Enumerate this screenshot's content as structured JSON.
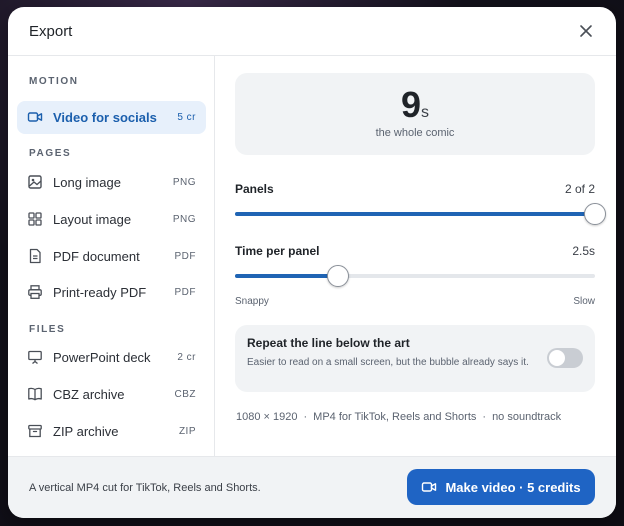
{
  "dialog": {
    "title": "Export",
    "close_icon": "close-icon"
  },
  "sidebar": {
    "sections": [
      {
        "label": "MOTION"
      },
      {
        "label": "PAGES"
      },
      {
        "label": "FILES"
      }
    ],
    "items": [
      {
        "label": "Video for socials",
        "tag": "5 cr",
        "icon": "video-icon",
        "active": true
      },
      {
        "label": "Long image",
        "tag": "PNG",
        "icon": "image-icon"
      },
      {
        "label": "Layout image",
        "tag": "PNG",
        "icon": "grid-icon"
      },
      {
        "label": "PDF document",
        "tag": "PDF",
        "icon": "document-icon"
      },
      {
        "label": "Print-ready PDF",
        "tag": "PDF",
        "icon": "printer-icon"
      },
      {
        "label": "PowerPoint deck",
        "tag": "2 cr",
        "icon": "presentation-icon"
      },
      {
        "label": "CBZ archive",
        "tag": "CBZ",
        "icon": "book-icon"
      },
      {
        "label": "ZIP archive",
        "tag": "ZIP",
        "icon": "archive-icon"
      }
    ]
  },
  "duration": {
    "value": "9",
    "unit": "s",
    "caption": "the whole comic"
  },
  "panels": {
    "label": "Panels",
    "value_text": "2 of 2",
    "fraction": 1.0
  },
  "time_per_panel": {
    "label": "Time per panel",
    "value_text": "2.5s",
    "fraction": 0.285,
    "min_label": "Snappy",
    "max_label": "Slow"
  },
  "repeat_line": {
    "title": "Repeat the line below the art",
    "description": "Easier to read on a small screen, but the bubble already says it.",
    "enabled": false
  },
  "meta": {
    "resolution": "1080 × 1920",
    "format": "MP4 for TikTok, Reels and Shorts",
    "audio": "no soundtrack",
    "separator": "·"
  },
  "footer": {
    "note": "A vertical MP4 cut for TikTok, Reels and Shorts.",
    "button_label": "Make video · 5 credits",
    "button_icon": "video-icon"
  },
  "colors": {
    "accent": "#1f64c4",
    "active_bg": "#e7f0fb",
    "active_text": "#1b5fad"
  }
}
